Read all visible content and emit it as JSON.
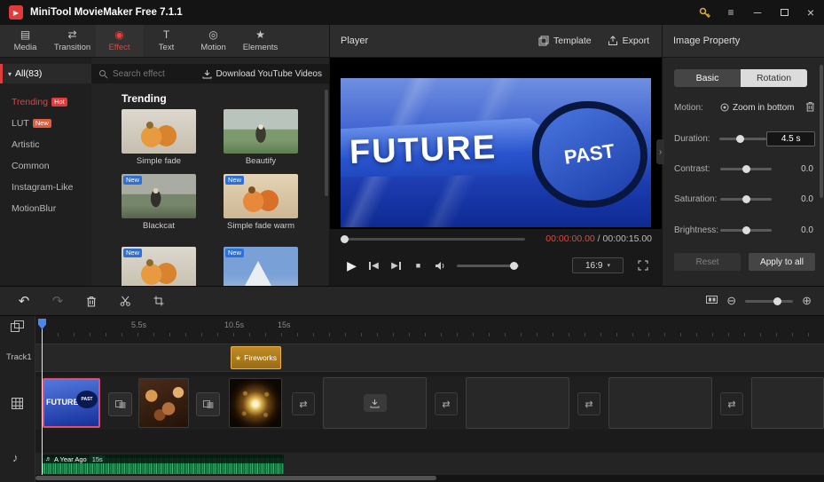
{
  "titlebar": {
    "title": "MiniTool MovieMaker Free 7.1.1"
  },
  "icons": {
    "logo": "▶",
    "menu": "≡",
    "minimize": "─",
    "close": "×",
    "media": "▤",
    "transition": "⇄",
    "effect": "◉",
    "text": "T",
    "motion": "◎",
    "elements": "★",
    "caret_down": "▾",
    "play": "▶",
    "prev": "◀",
    "next": "▶",
    "stop": "■",
    "swap": "⇄",
    "undo": "↶",
    "redo": "↷",
    "zoom_out": "⊖",
    "zoom_in": "⊕",
    "music": "♪",
    "note": "♬",
    "star": "★",
    "collapse": "›"
  },
  "tabs": [
    {
      "label": "Media"
    },
    {
      "label": "Transition"
    },
    {
      "label": "Effect"
    },
    {
      "label": "Text"
    },
    {
      "label": "Motion"
    },
    {
      "label": "Elements"
    }
  ],
  "effects": {
    "all_label": "All(83)",
    "search_placeholder": "Search effect",
    "download_label": "Download YouTube Videos",
    "section_title": "Trending",
    "categories": [
      {
        "label": "Trending",
        "badge": "Hot"
      },
      {
        "label": "LUT",
        "badge": "New"
      },
      {
        "label": "Artistic",
        "badge": ""
      },
      {
        "label": "Common",
        "badge": ""
      },
      {
        "label": "Instagram-Like",
        "badge": ""
      },
      {
        "label": "MotionBlur",
        "badge": ""
      }
    ],
    "items": [
      {
        "name": "Simple fade",
        "badge": ""
      },
      {
        "name": "Beautify",
        "badge": ""
      },
      {
        "name": "Blackcat",
        "badge": "New"
      },
      {
        "name": "Simple fade warm",
        "badge": "New"
      },
      {
        "name": "",
        "badge": "New"
      },
      {
        "name": "",
        "badge": "New"
      }
    ]
  },
  "player": {
    "title": "Player",
    "template_label": "Template",
    "export_label": "Export",
    "current_time": "00:00:00.00",
    "time_separator": " / ",
    "total_time": "00:00:15.00",
    "aspect_ratio": "16:9",
    "video_text_future": "FUTURE",
    "video_text_past": "PAST"
  },
  "properties": {
    "title": "Image Property",
    "tab_basic": "Basic",
    "tab_rotation": "Rotation",
    "motion_label": "Motion:",
    "motion_value": "Zoom in bottom",
    "duration": {
      "label": "Duration:",
      "value": "4.5 s"
    },
    "sliders": [
      {
        "label": "Contrast:",
        "value": "0.0"
      },
      {
        "label": "Saturation:",
        "value": "0.0"
      },
      {
        "label": "Brightness:",
        "value": "0.0"
      }
    ],
    "reset": "Reset",
    "apply": "Apply to all"
  },
  "timeline": {
    "track_label": "Track1",
    "ruler": [
      "5.5s",
      "10.5s",
      "15s"
    ],
    "fireworks_label": "Fireworks",
    "music": {
      "title": "A Year Ago",
      "duration": "15s"
    }
  }
}
